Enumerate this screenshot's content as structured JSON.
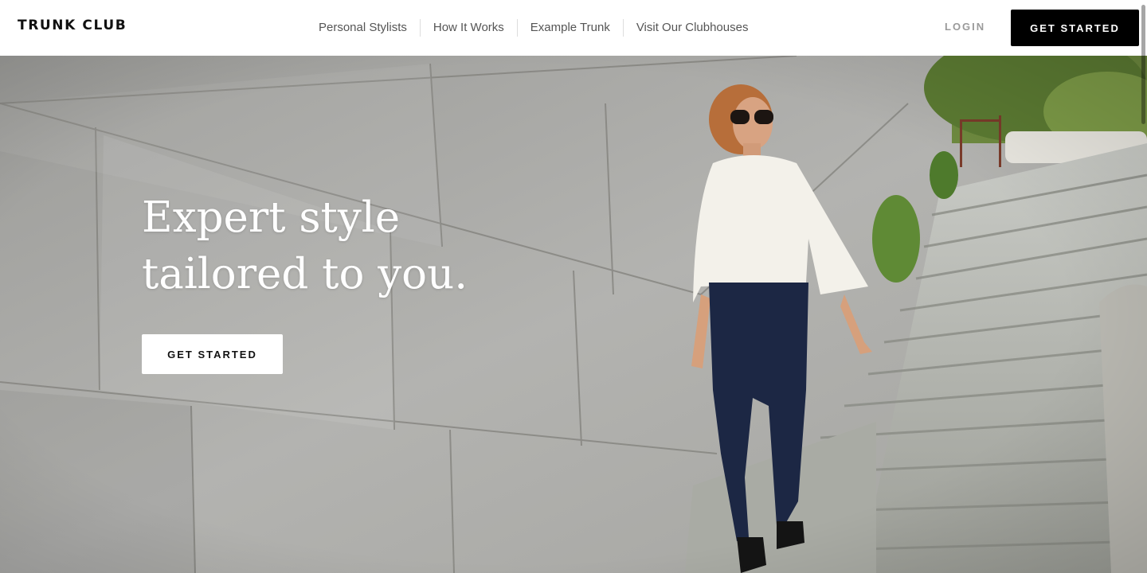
{
  "brand": {
    "logo_text": "TRUNK CLUB"
  },
  "nav": {
    "items": [
      {
        "label": "Personal Stylists"
      },
      {
        "label": "How It Works"
      },
      {
        "label": "Example Trunk"
      },
      {
        "label": "Visit Our Clubhouses"
      }
    ]
  },
  "header": {
    "login_label": "LOGIN",
    "cta_label": "GET STARTED"
  },
  "hero": {
    "headline_line1": "Expert style",
    "headline_line2": "tailored to you.",
    "cta_label": "GET STARTED"
  },
  "colors": {
    "cta_dark": "#000000",
    "cta_light": "#ffffff",
    "nav_text": "#555555",
    "login_text": "#9a9a9a"
  },
  "icons": {
    "scrollbar": "scrollbar-thumb"
  }
}
